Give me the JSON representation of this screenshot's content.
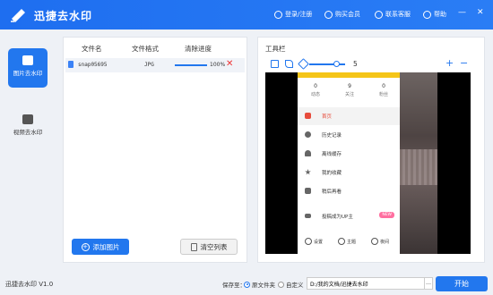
{
  "titlebar": {
    "app_name": "迅捷去水印",
    "login": "登录/注册",
    "buy": "购买会员",
    "service": "联系客服",
    "help": "帮助",
    "minimize": "—",
    "close": "✕"
  },
  "sidebar": {
    "items": [
      {
        "label": "图片去水印",
        "active": true
      },
      {
        "label": "视频去水印",
        "active": false
      }
    ]
  },
  "file_list": {
    "columns": [
      "文件名",
      "文件格式",
      "清除进度"
    ],
    "rows": [
      {
        "name": "snap05695",
        "format": "JPG",
        "progress_pct": 100,
        "progress_text": "100%"
      }
    ],
    "add_button": "添加图片",
    "clear_button": "清空列表"
  },
  "tools": {
    "title": "工具栏",
    "brush_size": "5",
    "zoom_in": "+",
    "zoom_out": "−"
  },
  "preview": {
    "stats": [
      {
        "n": "0",
        "l": "动态"
      },
      {
        "n": "9",
        "l": "关注"
      },
      {
        "n": "0",
        "l": "粉丝"
      }
    ],
    "menu": [
      {
        "label": "首页",
        "selected": true
      },
      {
        "label": "历史记录",
        "selected": false
      },
      {
        "label": "离线缓存",
        "selected": false
      },
      {
        "label": "我的收藏",
        "selected": false
      },
      {
        "label": "稍后再看",
        "selected": false
      },
      {
        "label": "投稿成为UP主",
        "selected": false
      }
    ],
    "new_badge": "NEW",
    "bottom": [
      "设置",
      "主题",
      "夜间"
    ]
  },
  "statusbar": {
    "version": "迅捷去水印 V1.0",
    "save_to": "保存至：",
    "options": [
      {
        "label": "原文件夹",
        "checked": true
      },
      {
        "label": "自定义",
        "checked": false
      }
    ],
    "path": "D:/我的文档/迅捷去水印",
    "browse": "…",
    "start_button": "开始"
  },
  "colors": {
    "accent": "#2277ee",
    "delete": "#e33333",
    "phone_header": "#f5c518",
    "selected_menu": "#e74c3c"
  }
}
